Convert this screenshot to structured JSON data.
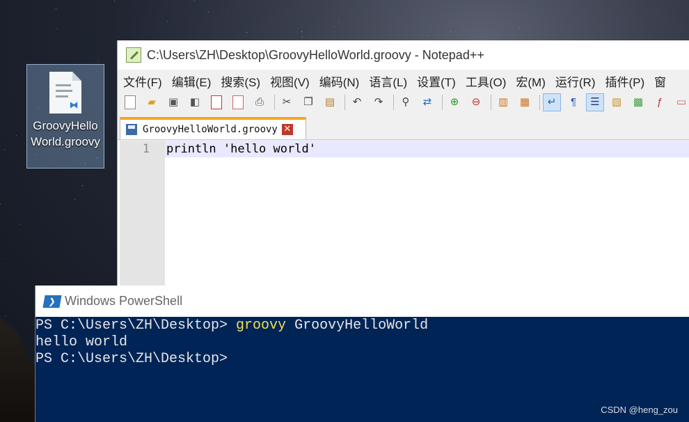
{
  "desktop": {
    "icon_label": "GroovyHelloWorld.groovy"
  },
  "notepad": {
    "title": "C:\\Users\\ZH\\Desktop\\GroovyHelloWorld.groovy - Notepad++",
    "menus": [
      "文件(F)",
      "编辑(E)",
      "搜索(S)",
      "视图(V)",
      "编码(N)",
      "语言(L)",
      "设置(T)",
      "工具(O)",
      "宏(M)",
      "运行(R)",
      "插件(P)",
      "窗"
    ],
    "tab_label": "GroovyHelloWorld.groovy",
    "line_number": "1",
    "code_line": "println 'hello world'"
  },
  "powershell": {
    "title": "Windows PowerShell",
    "prompt1": "PS C:\\Users\\ZH\\Desktop> ",
    "cmd_name": "groovy",
    "cmd_arg": " GroovyHelloWorld",
    "output": "hello world",
    "prompt2": "PS C:\\Users\\ZH\\Desktop>"
  },
  "watermark": "CSDN @heng_zou",
  "colors": {
    "ps_background": "#012456",
    "ps_command": "#f0e050",
    "tab_accent": "#f5a623",
    "current_line": "#e8e8ff"
  }
}
